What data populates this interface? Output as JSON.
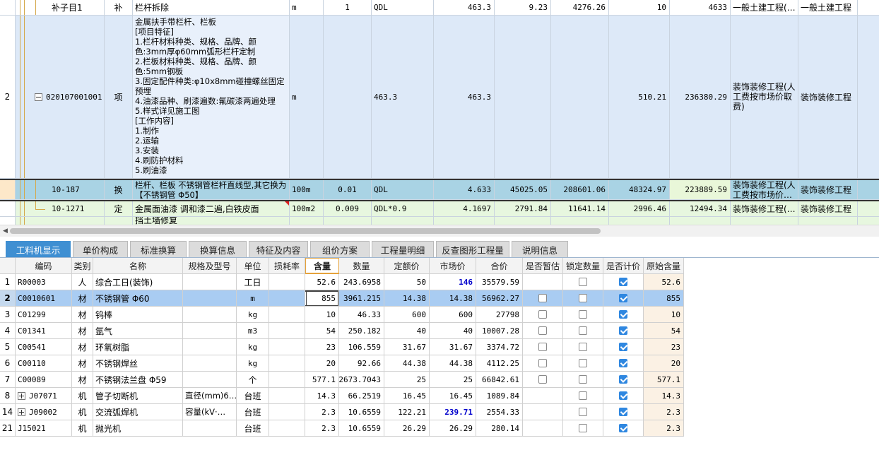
{
  "top_rows": [
    {
      "num": "",
      "code": "补子目1",
      "type": "补",
      "name": "栏杆拆除",
      "unit": "m",
      "quantity_expr": "1",
      "quantity": "QDL",
      "col8": "463.3",
      "col9": "9.23",
      "col10": "4276.26",
      "col11": "10",
      "col12": "4633",
      "specialty": "一般土建工程(…",
      "specialty2": "一般土建工程"
    },
    {
      "num": "2",
      "code": "020107001001",
      "type": "项",
      "name_lines": [
        "金属扶手带栏杆、栏板",
        "[项目特征]",
        "1.栏杆材料种类、规格、品牌、颜色:3mm厚φ60mm弧形栏杆定制",
        "2.栏板材料种类、规格、品牌、颜色:5mm钢板",
        "3.固定配件种类:φ10x8mm碰撞螺丝固定预埋",
        "4.油漆品种、刷漆遍数:氟碳漆两遍处理",
        "5.样式详见施工图",
        "[工作内容]",
        "1.制作",
        "2.运输",
        "3.安装",
        "4.刷防护材料",
        "5.刷油漆"
      ],
      "unit": "m",
      "quantity_expr": "463.3",
      "col8": "463.3",
      "col11": "510.21",
      "col12": "236380.29",
      "specialty": "装饰装修工程(人工费按市场价取费)",
      "specialty2": "装饰装修工程"
    },
    {
      "code": "10-187",
      "type": "换",
      "name": "栏杆、栏板 不锈钢管栏杆直线型,其它换为【不锈钢管 Φ50】",
      "unit": "100m",
      "quantity_expr": "0.01",
      "quantity": "QDL",
      "col8": "4.633",
      "col9": "45025.05",
      "col10": "208601.06",
      "col11": "48324.97",
      "col12": "223889.59",
      "specialty": "装饰装修工程(人工费按市场价…",
      "specialty2": "装饰装修工程"
    },
    {
      "code": "10-1271",
      "type": "定",
      "name": "金属面油漆 调和漆二遍,白铁皮面",
      "unit": "100m2",
      "quantity_expr": "0.009",
      "quantity": "QDL*0.9",
      "col8": "4.1697",
      "col9": "2791.84",
      "col10": "11641.14",
      "col11": "2996.46",
      "col12": "12494.34",
      "specialty": "装饰装修工程(…",
      "specialty2": "装饰装修工程"
    },
    {
      "name": "挡土墙修复"
    }
  ],
  "tabs": [
    "工料机显示",
    "单价构成",
    "标准换算",
    "换算信息",
    "特征及内容",
    "组价方案",
    "工程量明细",
    "反查图形工程量",
    "说明信息"
  ],
  "grid_headers": [
    "编码",
    "类别",
    "名称",
    "规格及型号",
    "单位",
    "损耗率",
    "含量",
    "数量",
    "定额价",
    "市场价",
    "合价",
    "是否暂估",
    "锁定数量",
    "是否计价",
    "原始含量"
  ],
  "grid_rows": [
    {
      "num": "1",
      "code": "R00003",
      "cat": "人",
      "name": "综合工日(装饰)",
      "spec": "",
      "unit": "工日",
      "loss": "",
      "content": "52.6",
      "qty": "243.6958",
      "quota": "50",
      "market": "146",
      "total": "35579.59",
      "est": null,
      "lock": false,
      "priced": true,
      "orig": "52.6",
      "market_blue": true,
      "expand": false
    },
    {
      "num": "2",
      "code": "C0010601",
      "cat": "材",
      "name": "不锈钢管 Φ60",
      "spec": "",
      "unit": "m",
      "loss": "",
      "content": "855",
      "qty": "3961.215",
      "quota": "14.38",
      "market": "14.38",
      "total": "56962.27",
      "est": false,
      "lock": false,
      "priced": true,
      "orig": "855",
      "market_blue": false,
      "expand": false,
      "selected": true
    },
    {
      "num": "3",
      "code": "C01299",
      "cat": "材",
      "name": "钨棒",
      "spec": "",
      "unit": "kg",
      "loss": "",
      "content": "10",
      "qty": "46.33",
      "quota": "600",
      "market": "600",
      "total": "27798",
      "est": false,
      "lock": false,
      "priced": true,
      "orig": "10",
      "market_blue": false,
      "expand": false
    },
    {
      "num": "4",
      "code": "C01341",
      "cat": "材",
      "name": "氩气",
      "spec": "",
      "unit": "m3",
      "loss": "",
      "content": "54",
      "qty": "250.182",
      "quota": "40",
      "market": "40",
      "total": "10007.28",
      "est": false,
      "lock": false,
      "priced": true,
      "orig": "54",
      "market_blue": false,
      "expand": false
    },
    {
      "num": "5",
      "code": "C00541",
      "cat": "材",
      "name": "环氧树脂",
      "spec": "",
      "unit": "kg",
      "loss": "",
      "content": "23",
      "qty": "106.559",
      "quota": "31.67",
      "market": "31.67",
      "total": "3374.72",
      "est": false,
      "lock": false,
      "priced": true,
      "orig": "23",
      "market_blue": false,
      "expand": false
    },
    {
      "num": "6",
      "code": "C00110",
      "cat": "材",
      "name": "不锈钢焊丝",
      "spec": "",
      "unit": "kg",
      "loss": "",
      "content": "20",
      "qty": "92.66",
      "quota": "44.38",
      "market": "44.38",
      "total": "4112.25",
      "est": false,
      "lock": false,
      "priced": true,
      "orig": "20",
      "market_blue": false,
      "expand": false
    },
    {
      "num": "7",
      "code": "C00089",
      "cat": "材",
      "name": "不锈钢法兰盘 Φ59",
      "spec": "",
      "unit": "个",
      "loss": "",
      "content": "577.1",
      "qty": "2673.7043",
      "quota": "25",
      "market": "25",
      "total": "66842.61",
      "est": false,
      "lock": false,
      "priced": true,
      "orig": "577.1",
      "market_blue": false,
      "expand": false
    },
    {
      "num": "8",
      "code": "J07071",
      "cat": "机",
      "name": "管子切断机",
      "spec": "直径(mm)6…",
      "unit": "台班",
      "loss": "",
      "content": "14.3",
      "qty": "66.2519",
      "quota": "16.45",
      "market": "16.45",
      "total": "1089.84",
      "est": null,
      "lock": false,
      "priced": true,
      "orig": "14.3",
      "market_blue": false,
      "expand": true
    },
    {
      "num": "14",
      "code": "J09002",
      "cat": "机",
      "name": "交流弧焊机",
      "spec": "容量(kV·…",
      "unit": "台班",
      "loss": "",
      "content": "2.3",
      "qty": "10.6559",
      "quota": "122.21",
      "market": "239.71",
      "total": "2554.33",
      "est": null,
      "lock": false,
      "priced": true,
      "orig": "2.3",
      "market_blue": true,
      "expand": true
    },
    {
      "num": "21",
      "code": "J15021",
      "cat": "机",
      "name": "抛光机",
      "spec": "",
      "unit": "台班",
      "loss": "",
      "content": "2.3",
      "qty": "10.6559",
      "quota": "26.29",
      "market": "26.29",
      "total": "280.14",
      "est": null,
      "lock": false,
      "priced": true,
      "orig": "2.3",
      "market_blue": false,
      "expand": false
    }
  ]
}
